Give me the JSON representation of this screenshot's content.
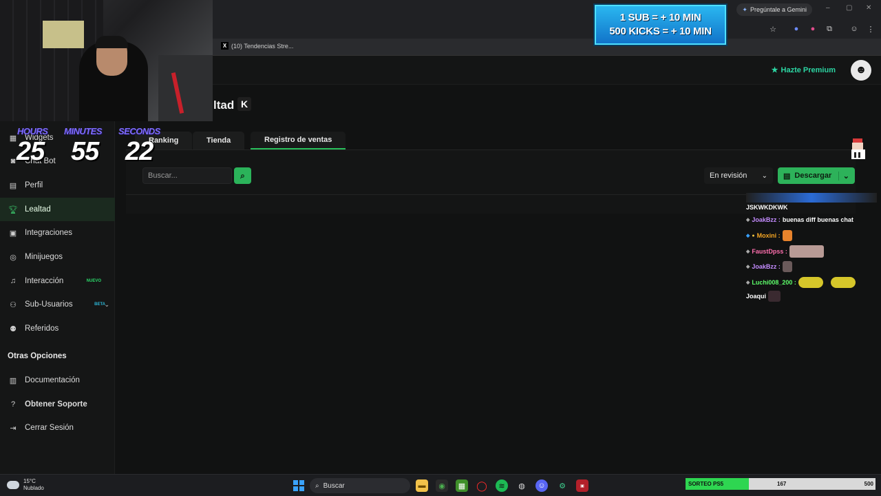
{
  "browser": {
    "bookmark_tab": "(10) Tendencias Stre...",
    "gemini_button": "Pregúntale a Gemini",
    "window_controls": [
      "–",
      "▢",
      "✕"
    ]
  },
  "topbar": {
    "premium_label": "Hazte Premium"
  },
  "sidebar": {
    "items": [
      {
        "label": "Widgets",
        "icon": "grid-icon"
      },
      {
        "label": "Chat Bot",
        "icon": "robot-icon"
      },
      {
        "label": "Perfil",
        "icon": "id-card-icon"
      },
      {
        "label": "Lealtad",
        "icon": "trophy-icon",
        "active": true
      },
      {
        "label": "Integraciones",
        "icon": "plug-icon"
      },
      {
        "label": "Minijuegos",
        "icon": "gamepad-icon"
      },
      {
        "label": "Interacción",
        "icon": "music-icon",
        "badge": "NUEVO",
        "badge_color": "#2bd96a"
      },
      {
        "label": "Sub-Usuarios",
        "icon": "users-icon",
        "badge": "BETA",
        "badge_color": "#2cb6d6"
      },
      {
        "label": "Referidos",
        "icon": "people-icon"
      }
    ],
    "other_header": "Otras Opciones",
    "other_items": [
      {
        "label": "Documentación",
        "icon": "document-icon"
      },
      {
        "label": "Obtener Soporte",
        "icon": "help-icon"
      },
      {
        "label": "Cerrar Sesión",
        "icon": "logout-icon"
      }
    ]
  },
  "main": {
    "page_title": "ltad",
    "tabs": [
      {
        "label": "Ranking"
      },
      {
        "label": "Tienda"
      },
      {
        "label": "Registro de ventas",
        "active": true
      }
    ],
    "search_placeholder": "Buscar...",
    "status_select": "En revisión",
    "download_button": "Descargar"
  },
  "overlay": {
    "timer": {
      "hours_label": "HOURS",
      "hours": "25",
      "minutes_label": "MINUTES",
      "minutes": "55",
      "seconds_label": "SECONDS",
      "seconds": "22"
    },
    "sub_banner": [
      "1 SUB = + 10 MIN",
      "500 KICKS = + 10 MIN"
    ],
    "chat": [
      {
        "user": "JSKWKDKWK",
        "message": "",
        "color": "#ffffff"
      },
      {
        "user": "JoakBzz :",
        "message": "buenas diff buenas chat",
        "color": "#c48cff"
      },
      {
        "user": "Moxini :",
        "message": "",
        "color": "#f5a623"
      },
      {
        "user": "FaustDpss :",
        "message": "",
        "color": "#ff6fae"
      },
      {
        "user": "JoakBzz :",
        "message": "",
        "color": "#c48cff"
      },
      {
        "user": "Luchi008_200 :",
        "message": "",
        "color": "#5dff6a"
      },
      {
        "user": "Joaqui",
        "message": "",
        "color": "#ffffff"
      }
    ]
  },
  "taskbar": {
    "temperature": "15°C",
    "weather": "Nublado",
    "search_label": "Buscar",
    "goal_label": "SORTEO PS5",
    "goal_current": "167",
    "goal_max": "500",
    "goal_fraction": 0.334
  }
}
